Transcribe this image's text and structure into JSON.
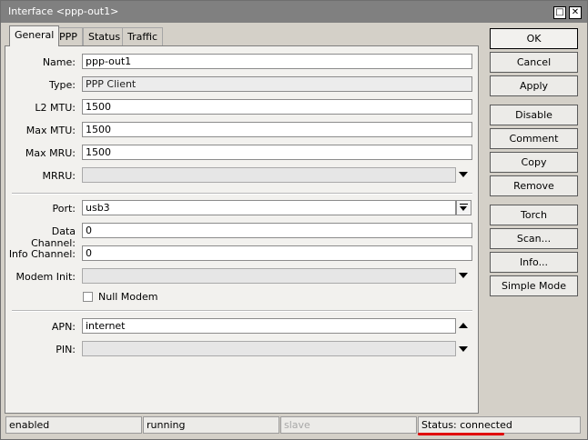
{
  "window": {
    "title": "Interface <ppp-out1>"
  },
  "title_buttons": {
    "max": "□",
    "close": "✕"
  },
  "tabs": [
    {
      "label": "General",
      "active": true
    },
    {
      "label": "PPP"
    },
    {
      "label": "Status"
    },
    {
      "label": "Traffic"
    }
  ],
  "fields": {
    "name": {
      "label": "Name:",
      "value": "ppp-out1"
    },
    "type": {
      "label": "Type:",
      "value": "PPP Client"
    },
    "l2mtu": {
      "label": "L2 MTU:",
      "value": "1500"
    },
    "max_mtu": {
      "label": "Max MTU:",
      "value": "1500"
    },
    "max_mru": {
      "label": "Max MRU:",
      "value": "1500"
    },
    "mrru": {
      "label": "MRRU:",
      "value": ""
    },
    "port": {
      "label": "Port:",
      "value": "usb3"
    },
    "data_channel": {
      "label": "Data Channel:",
      "value": "0"
    },
    "info_channel": {
      "label": "Info Channel:",
      "value": "0"
    },
    "modem_init": {
      "label": "Modem Init:",
      "value": ""
    },
    "null_modem": {
      "label": "Null Modem",
      "checked": false
    },
    "apn": {
      "label": "APN:",
      "value": "internet"
    },
    "pin": {
      "label": "PIN:",
      "value": ""
    }
  },
  "buttons": {
    "ok": "OK",
    "cancel": "Cancel",
    "apply": "Apply",
    "disable": "Disable",
    "comment": "Comment",
    "copy": "Copy",
    "remove": "Remove",
    "torch": "Torch",
    "scan": "Scan...",
    "info": "Info...",
    "simple_mode": "Simple Mode"
  },
  "statusbar": {
    "enabled": "enabled",
    "running": "running",
    "slave": "slave",
    "status": "Status: connected"
  },
  "colors": {
    "highlight_underline": "#e00000",
    "titlebar": "#808080"
  }
}
